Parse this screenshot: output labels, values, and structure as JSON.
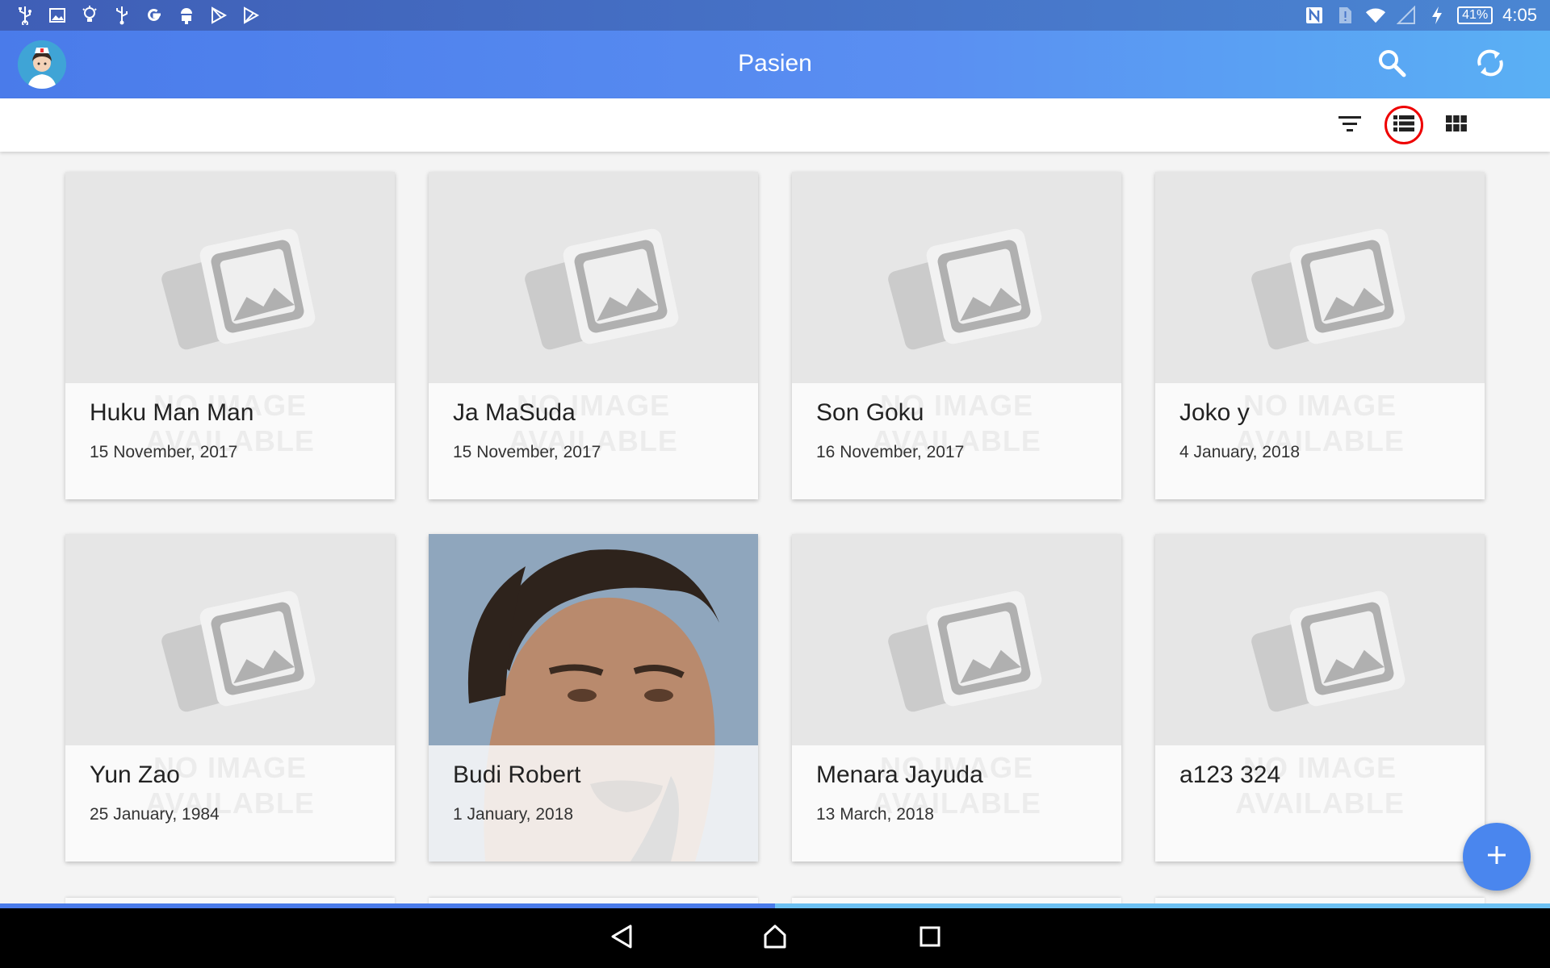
{
  "status_bar": {
    "left_icons": [
      "usb-icon",
      "image-icon",
      "bulb-icon",
      "usb-debug-icon",
      "google-icon",
      "android-icon",
      "play-store-icon",
      "play-store-icon"
    ],
    "right_icons": [
      "nfc-icon",
      "sim-alert-icon",
      "wifi-icon",
      "signal-icon",
      "charging-icon"
    ],
    "battery": "41%",
    "time": "4:05"
  },
  "app_bar": {
    "title": "Pasien",
    "search_icon": "search-icon",
    "sync_icon": "sync-icon"
  },
  "toolbar": {
    "filter_icon": "filter-icon",
    "list_icon": "list-view-icon",
    "grid_icon": "grid-view-icon"
  },
  "placeholder_text": {
    "line1": "NO IMAGE",
    "line2": "AVAILABLE"
  },
  "patients": [
    {
      "name": "Huku Man Man",
      "date": "15 November, 2017",
      "has_photo": false
    },
    {
      "name": "Ja MaSuda",
      "date": "15 November, 2017",
      "has_photo": false
    },
    {
      "name": "Son Goku",
      "date": "16 November, 2017",
      "has_photo": false
    },
    {
      "name": "Joko y",
      "date": "4 January, 2018",
      "has_photo": false
    },
    {
      "name": "Yun Zao",
      "date": "25 January, 1984",
      "has_photo": false
    },
    {
      "name": "Budi Robert",
      "date": "1 January, 2018",
      "has_photo": true
    },
    {
      "name": "Menara Jayuda",
      "date": "13 March, 2018",
      "has_photo": false
    },
    {
      "name": "a123 324",
      "date": "",
      "has_photo": false
    }
  ],
  "fab": {
    "icon": "plus-icon"
  },
  "nav_bar": {
    "icons": [
      "back-icon",
      "home-icon",
      "recents-icon"
    ]
  },
  "colors": {
    "status_bar": "#3f5eb6",
    "app_bar": "#4a7bea",
    "fab": "#4a86ee",
    "highlight_ring": "#e00000"
  },
  "scroll_progress": 0.5
}
